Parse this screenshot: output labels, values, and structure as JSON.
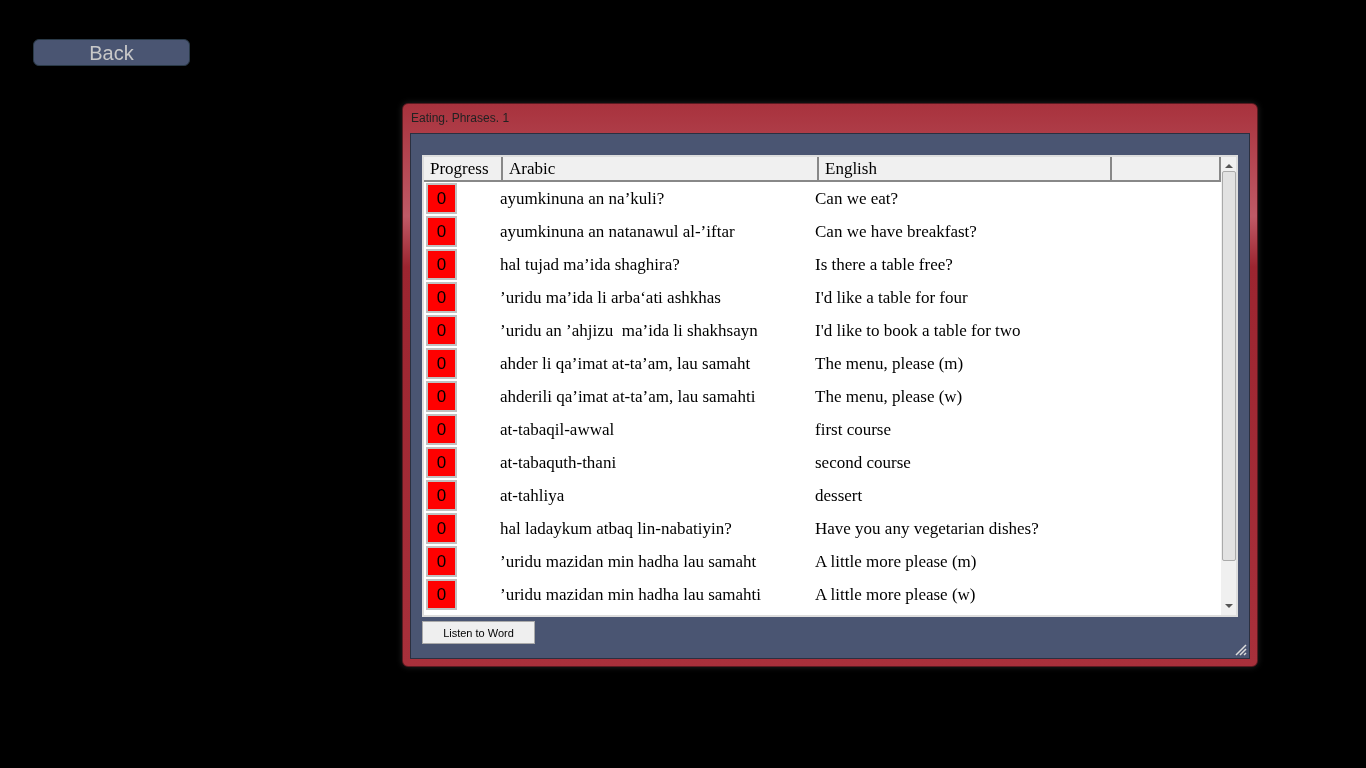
{
  "back_button": "Back",
  "window": {
    "title": "Eating. Phrases. 1"
  },
  "table": {
    "columns": [
      "Progress",
      "Arabic",
      "English"
    ],
    "rows": [
      {
        "progress": "0",
        "arabic": "ayumkinuna an na’kuli?",
        "english": "Can we eat?"
      },
      {
        "progress": "0",
        "arabic": "ayumkinuna an natanawul al-’iftar",
        "english": "Can we have breakfast?"
      },
      {
        "progress": "0",
        "arabic": "hal tujad ma’ida shaghira?",
        "english": "Is there a table free?"
      },
      {
        "progress": "0",
        "arabic": "’uridu ma’ida li arba‘ati ashkhas",
        "english": "I'd like a table for four"
      },
      {
        "progress": "0",
        "arabic": "’uridu an ’ahjizu  ma’ida li shakhsayn",
        "english": "I'd like to book a table for two"
      },
      {
        "progress": "0",
        "arabic": "ahder li qa’imat at-ta’am, lau samaht",
        "english": "The menu, please (m)"
      },
      {
        "progress": "0",
        "arabic": "ahderili qa’imat at-ta’am, lau samahti",
        "english": "The menu, please (w)"
      },
      {
        "progress": "0",
        "arabic": "at-tabaqil-awwal",
        "english": "first course"
      },
      {
        "progress": "0",
        "arabic": "at-tabaquth-thani",
        "english": "second course"
      },
      {
        "progress": "0",
        "arabic": "at-tahliya",
        "english": "dessert"
      },
      {
        "progress": "0",
        "arabic": "hal ladaykum atbaq lin-nabatiyin?",
        "english": "Have you any vegetarian dishes?"
      },
      {
        "progress": "0",
        "arabic": "’uridu mazidan min hadha lau samaht",
        "english": "A little more please (m)"
      },
      {
        "progress": "0",
        "arabic": "’uridu mazidan min hadha lau samahti",
        "english": "A little more please (w)"
      }
    ]
  },
  "listen_button": "Listen to Word"
}
